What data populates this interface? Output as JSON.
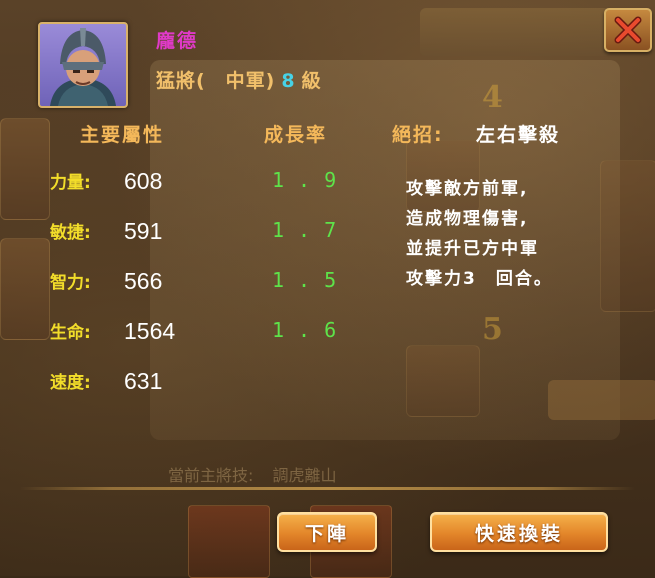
{
  "general": {
    "name": "龐德",
    "role": "猛將(　中軍)",
    "level": "8",
    "level_unit": "級"
  },
  "headers": {
    "main_attrs": "主要屬性",
    "growth_rate": "成長率",
    "ultimate_label": "絕招:"
  },
  "ultimate": {
    "name": "左右擊殺",
    "description": [
      "攻擊敵方前軍,",
      "造成物理傷害,",
      "並提升已方中軍",
      "攻擊力3　回合。"
    ]
  },
  "stats": [
    {
      "label": "力量:",
      "value": "608",
      "growth": "1.9"
    },
    {
      "label": "敏捷:",
      "value": "591",
      "growth": "1.7"
    },
    {
      "label": "智力:",
      "value": "566",
      "growth": "1.5"
    },
    {
      "label": "生命:",
      "value": "1564",
      "growth": "1.6"
    },
    {
      "label": "速度:",
      "value": "631"
    }
  ],
  "background_skill": {
    "label": "當前主將技:",
    "value": "調虎離山"
  },
  "buttons": {
    "dismount": "下陣",
    "quick_equip": "快速換裝"
  },
  "icons": {
    "close": "close-x-icon",
    "portrait": "general-portrait"
  },
  "colors": {
    "name": "#e03ac8",
    "level": "#47d2e6",
    "header": "#f4b85a",
    "stat_label": "#f2dd2a",
    "growth": "#5ee34a",
    "button": "#e3862a"
  }
}
